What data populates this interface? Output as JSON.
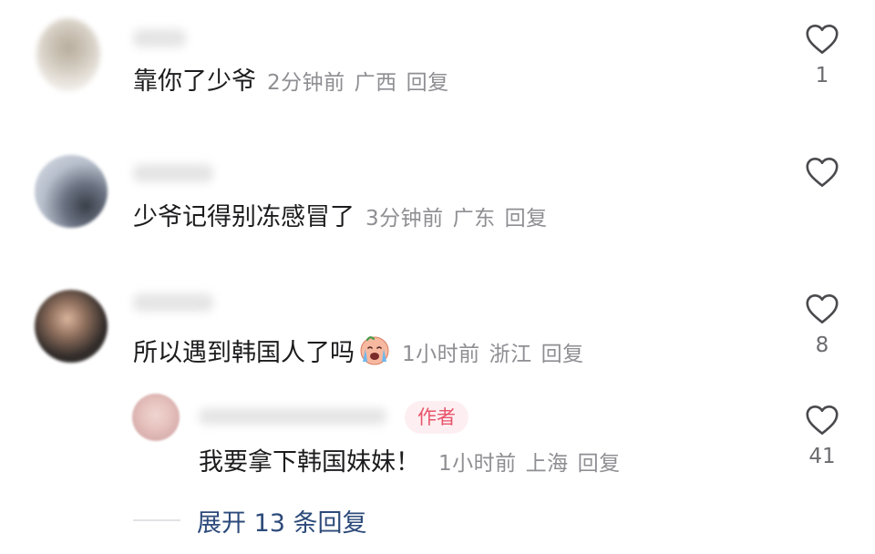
{
  "comments": [
    {
      "text": "靠你了少爷",
      "time": "2分钟前",
      "location": "广西",
      "reply": "回复",
      "likes": "1"
    },
    {
      "text": "少爷记得别冻感冒了",
      "time": "3分钟前",
      "location": "广东",
      "reply": "回复",
      "likes": ""
    },
    {
      "text": "所以遇到韩国人了吗",
      "emoji": "crying-face-emoji",
      "time": "1小时前",
      "location": "浙江",
      "reply": "回复",
      "likes": "8"
    }
  ],
  "author_reply": {
    "badge": "作者",
    "text": "我要拿下韩国妹妹！",
    "time": "1小时前",
    "location": "上海",
    "reply": "回复",
    "likes": "41"
  },
  "expand": {
    "label": "展开 13 条回复"
  },
  "colors": {
    "text": "#1c1c1e",
    "meta": "#8e8e93",
    "badge_bg": "#fdeff1",
    "badge_text": "#e8546b",
    "expand_text": "#2c4a7a"
  }
}
